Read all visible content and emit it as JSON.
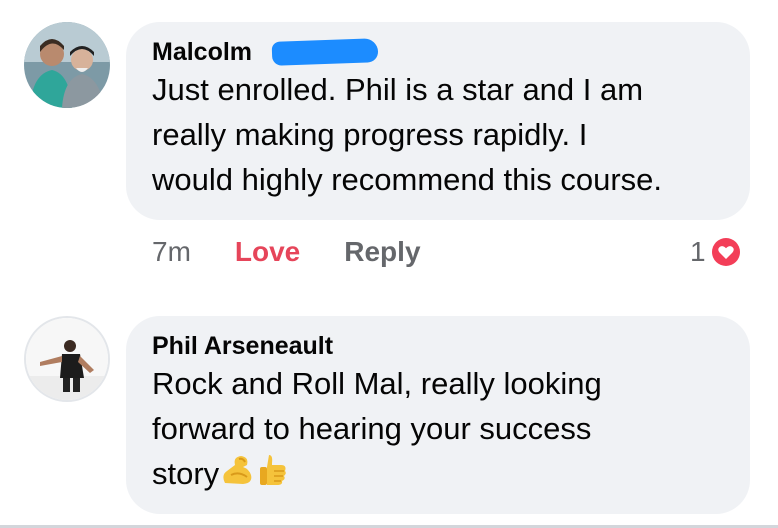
{
  "comments": [
    {
      "author": "Malcolm",
      "lines": [
        "Just enrolled. Phil is a star and I am",
        "really making progress rapidly. I",
        "would highly recommend this course."
      ],
      "time": "7m",
      "love_label": "Love",
      "reply_label": "Reply",
      "reaction_count": "1",
      "reaction_icon": "heart-icon"
    },
    {
      "author": "Phil Arseneault",
      "lines": [
        "Rock and Roll Mal, really looking",
        "forward to hearing your success",
        "story"
      ],
      "emojis": [
        "flexed-biceps-icon",
        "thumbs-up-icon"
      ]
    }
  ],
  "colors": {
    "bubble": "#f0f2f5",
    "love": "#e6455a",
    "meta": "#65676b",
    "redaction": "#1c8cff"
  }
}
